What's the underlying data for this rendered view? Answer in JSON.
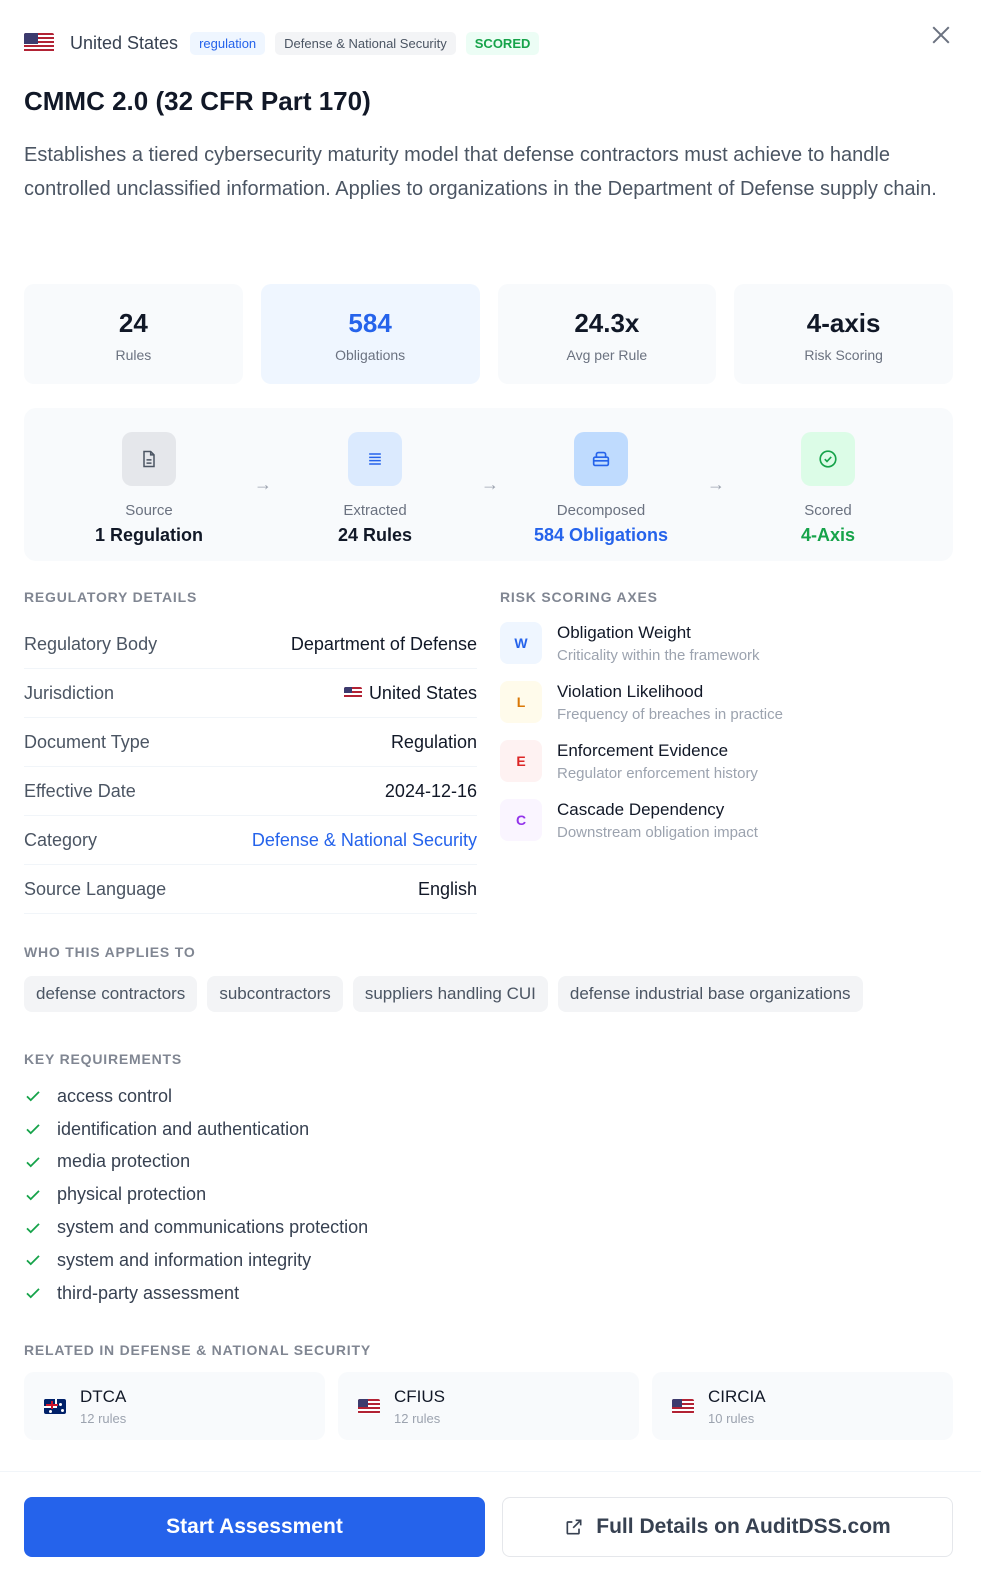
{
  "header": {
    "country": "United States",
    "tags": [
      "regulation",
      "Defense & National Security",
      "SCORED"
    ]
  },
  "title": "CMMC 2.0 (32 CFR Part 170)",
  "description": "Establishes a tiered cybersecurity maturity model that defense contractors must achieve to handle controlled unclassified information. Applies to organizations in the Department of Defense supply chain.",
  "stats": [
    {
      "value": "24",
      "label": "Rules"
    },
    {
      "value": "584",
      "label": "Obligations"
    },
    {
      "value": "24.3x",
      "label": "Avg per Rule"
    },
    {
      "value": "4-axis",
      "label": "Risk Scoring"
    }
  ],
  "pipeline": [
    {
      "label": "Source",
      "value": "1 Regulation",
      "icon": "document-icon"
    },
    {
      "label": "Extracted",
      "value": "24 Rules",
      "icon": "list-icon"
    },
    {
      "label": "Decomposed",
      "value": "584 Obligations",
      "icon": "layers-icon"
    },
    {
      "label": "Scored",
      "value": "4-Axis",
      "icon": "check-circle-icon"
    }
  ],
  "details": {
    "heading": "REGULATORY DETAILS",
    "rows": [
      {
        "key": "Regulatory Body",
        "value": "Department of Defense"
      },
      {
        "key": "Jurisdiction",
        "value": "United States"
      },
      {
        "key": "Document Type",
        "value": "Regulation"
      },
      {
        "key": "Effective Date",
        "value": "2024-12-16"
      },
      {
        "key": "Category",
        "value": "Defense & National Security"
      },
      {
        "key": "Source Language",
        "value": "English"
      }
    ]
  },
  "axes": {
    "heading": "RISK SCORING AXES",
    "items": [
      {
        "letter": "W",
        "name": "Obligation Weight",
        "desc": "Criticality within the framework",
        "color": "#2563eb",
        "bg": "#eff6ff"
      },
      {
        "letter": "L",
        "name": "Violation Likelihood",
        "desc": "Frequency of breaches in practice",
        "color": "#d97706",
        "bg": "#fffbeb"
      },
      {
        "letter": "E",
        "name": "Enforcement Evidence",
        "desc": "Regulator enforcement history",
        "color": "#dc2626",
        "bg": "#fef2f2"
      },
      {
        "letter": "C",
        "name": "Cascade Dependency",
        "desc": "Downstream obligation impact",
        "color": "#9333ea",
        "bg": "#faf5ff"
      }
    ]
  },
  "applies": {
    "heading": "WHO THIS APPLIES TO",
    "items": [
      "defense contractors",
      "subcontractors",
      "suppliers handling CUI",
      "defense industrial base organizations"
    ]
  },
  "requirements": {
    "heading": "KEY REQUIREMENTS",
    "items": [
      "access control",
      "identification and authentication",
      "media protection",
      "physical protection",
      "system and communications protection",
      "system and information integrity",
      "third-party assessment"
    ]
  },
  "related": {
    "heading": "RELATED IN DEFENSE & NATIONAL SECURITY",
    "items": [
      {
        "name": "DTCA",
        "rules": "12 rules",
        "flag": "au"
      },
      {
        "name": "CFIUS",
        "rules": "12 rules",
        "flag": "us"
      },
      {
        "name": "CIRCIA",
        "rules": "10 rules",
        "flag": "us"
      }
    ]
  },
  "actions": {
    "primary": "Start Assessment",
    "secondary": "Full Details on AuditDSS.com"
  },
  "colors": {
    "accent": "#2563eb",
    "success": "#16a34a"
  }
}
